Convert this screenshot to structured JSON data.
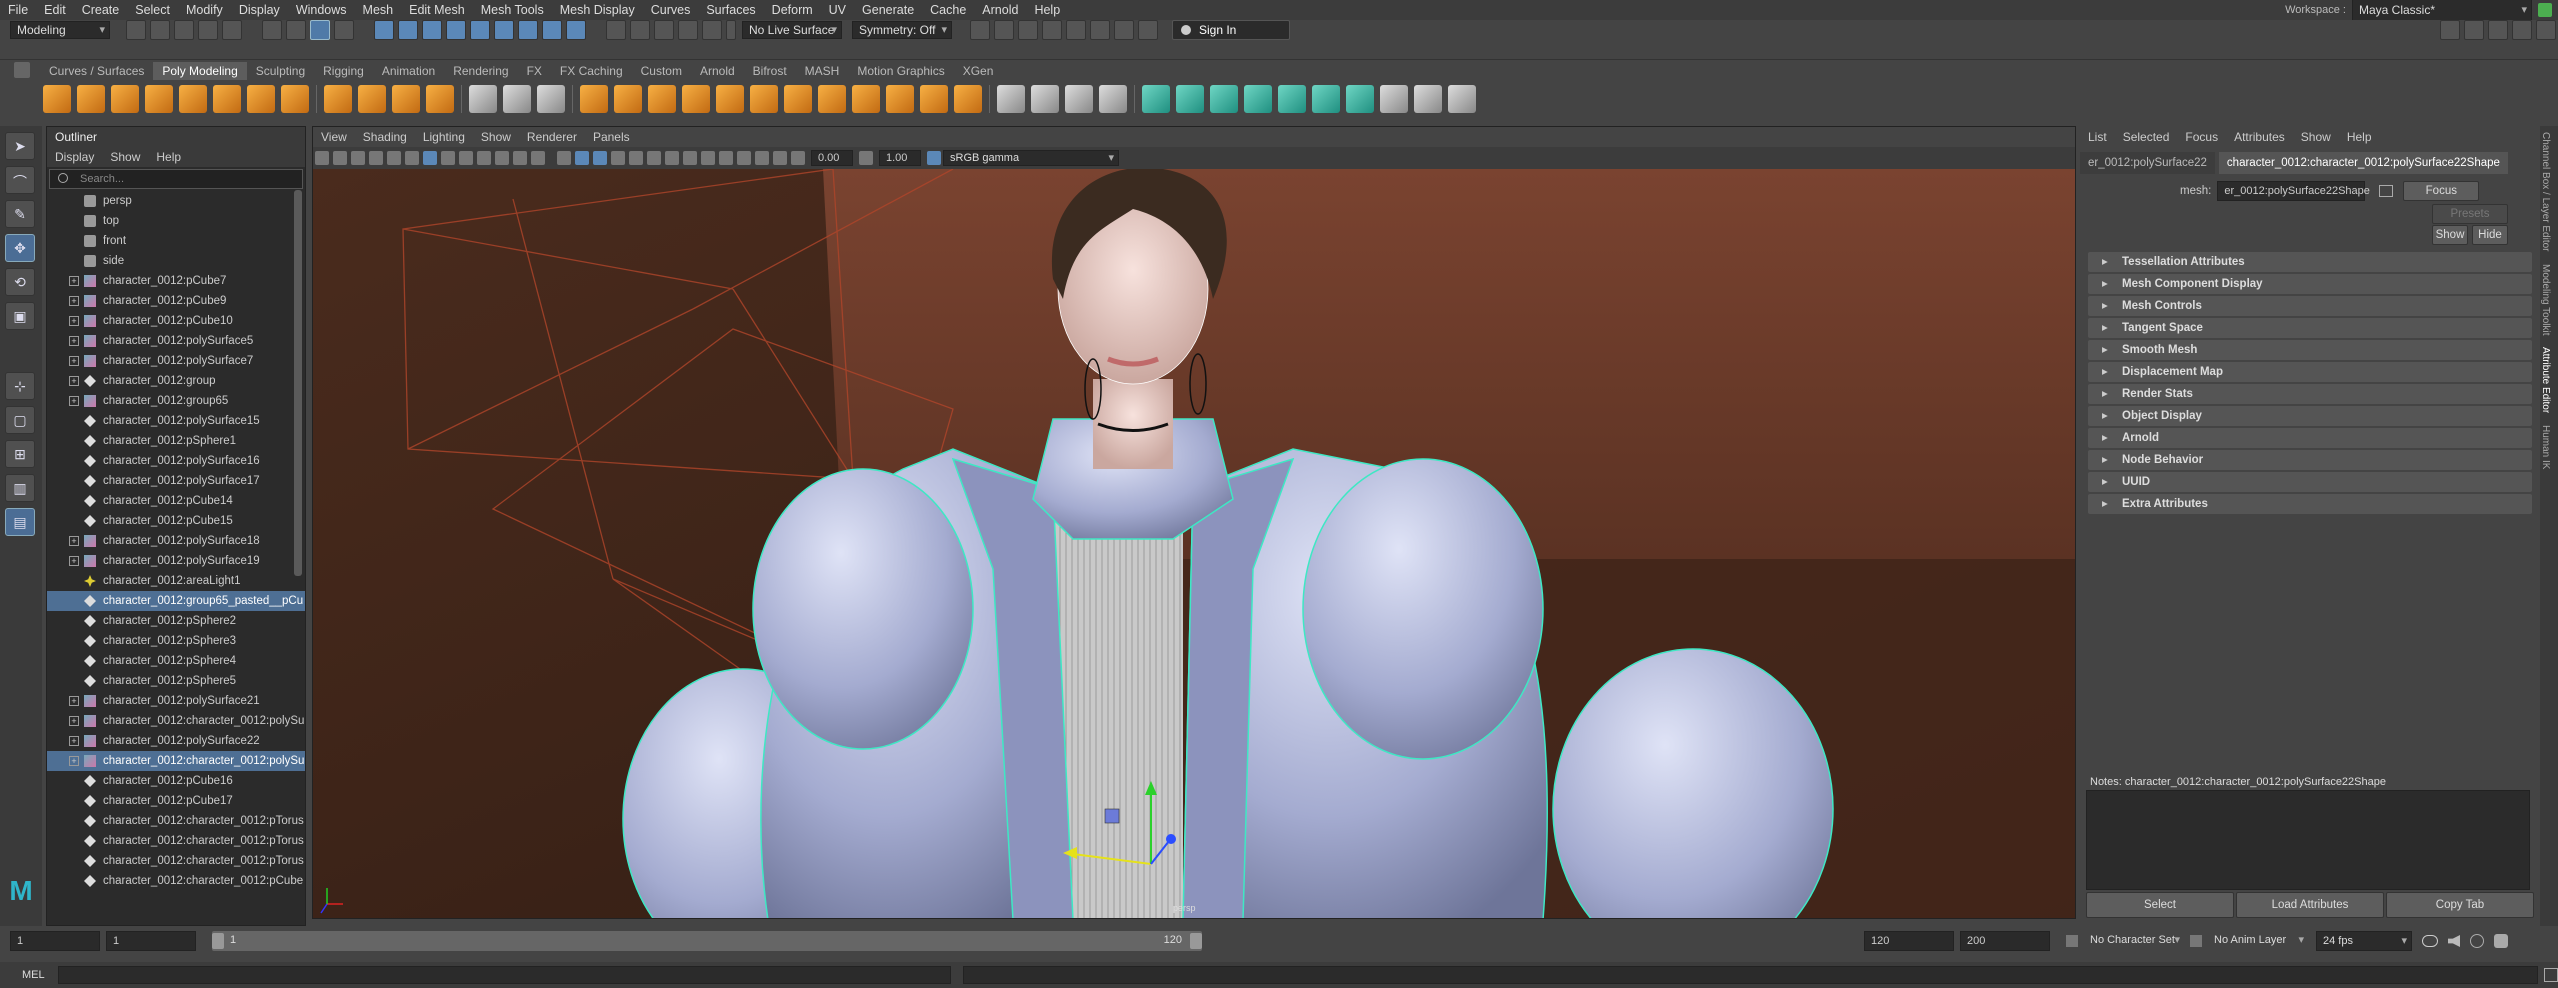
{
  "menubar": {
    "items": [
      "File",
      "Edit",
      "Create",
      "Select",
      "Modify",
      "Display",
      "Windows",
      "Mesh",
      "Edit Mesh",
      "Mesh Tools",
      "Mesh Display",
      "Curves",
      "Surfaces",
      "Deform",
      "UV",
      "Generate",
      "Cache",
      "Arnold",
      "Help"
    ],
    "workspace_label": "Workspace :",
    "workspace_value": "Maya Classic*"
  },
  "status": {
    "mode": "Modeling",
    "live_surface": "No Live Surface",
    "symmetry": "Symmetry: Off",
    "sign_in": "Sign In"
  },
  "shelf_tabs": [
    {
      "label": "Curves / Surfaces",
      "active": false
    },
    {
      "label": "Poly Modeling",
      "active": true
    },
    {
      "label": "Sculpting",
      "active": false
    },
    {
      "label": "Rigging",
      "active": false
    },
    {
      "label": "Animation",
      "active": false
    },
    {
      "label": "Rendering",
      "active": false
    },
    {
      "label": "FX",
      "active": false
    },
    {
      "label": "FX Caching",
      "active": false
    },
    {
      "label": "Custom",
      "active": false
    },
    {
      "label": "Arnold",
      "active": false
    },
    {
      "label": "Bifrost",
      "active": false
    },
    {
      "label": "MASH",
      "active": false
    },
    {
      "label": "Motion Graphics",
      "active": false
    },
    {
      "label": "XGen",
      "active": false
    }
  ],
  "outliner": {
    "title": "Outliner",
    "menu": [
      "Display",
      "Show",
      "Help"
    ],
    "search_placeholder": "Search...",
    "items": [
      {
        "label": "persp",
        "icon": "cam",
        "exp": false,
        "sel": false
      },
      {
        "label": "top",
        "icon": "cam",
        "exp": false,
        "sel": false
      },
      {
        "label": "front",
        "icon": "cam",
        "exp": false,
        "sel": false
      },
      {
        "label": "side",
        "icon": "cam",
        "exp": false,
        "sel": false
      },
      {
        "label": "character_0012:pCube7",
        "icon": "mesh",
        "exp": true,
        "sel": false
      },
      {
        "label": "character_0012:pCube9",
        "icon": "mesh",
        "exp": true,
        "sel": false
      },
      {
        "label": "character_0012:pCube10",
        "icon": "mesh",
        "exp": true,
        "sel": false
      },
      {
        "label": "character_0012:polySurface5",
        "icon": "mesh",
        "exp": true,
        "sel": false
      },
      {
        "label": "character_0012:polySurface7",
        "icon": "mesh",
        "exp": true,
        "sel": false
      },
      {
        "label": "character_0012:group",
        "icon": "grp",
        "exp": true,
        "sel": false
      },
      {
        "label": "character_0012:group65",
        "icon": "mesh",
        "exp": true,
        "sel": false
      },
      {
        "label": "character_0012:polySurface15",
        "icon": "grp",
        "exp": false,
        "sel": false
      },
      {
        "label": "character_0012:pSphere1",
        "icon": "grp",
        "exp": false,
        "sel": false
      },
      {
        "label": "character_0012:polySurface16",
        "icon": "grp",
        "exp": false,
        "sel": false
      },
      {
        "label": "character_0012:polySurface17",
        "icon": "grp",
        "exp": false,
        "sel": false
      },
      {
        "label": "character_0012:pCube14",
        "icon": "grp",
        "exp": false,
        "sel": false
      },
      {
        "label": "character_0012:pCube15",
        "icon": "grp",
        "exp": false,
        "sel": false
      },
      {
        "label": "character_0012:polySurface18",
        "icon": "mesh",
        "exp": true,
        "sel": false
      },
      {
        "label": "character_0012:polySurface19",
        "icon": "mesh",
        "exp": true,
        "sel": false
      },
      {
        "label": "character_0012:areaLight1",
        "icon": "light",
        "exp": false,
        "sel": false
      },
      {
        "label": "character_0012:group65_pasted__pCu",
        "icon": "grp",
        "exp": false,
        "sel": true
      },
      {
        "label": "character_0012:pSphere2",
        "icon": "grp",
        "exp": false,
        "sel": false
      },
      {
        "label": "character_0012:pSphere3",
        "icon": "grp",
        "exp": false,
        "sel": false
      },
      {
        "label": "character_0012:pSphere4",
        "icon": "grp",
        "exp": false,
        "sel": false
      },
      {
        "label": "character_0012:pSphere5",
        "icon": "grp",
        "exp": false,
        "sel": false
      },
      {
        "label": "character_0012:polySurface21",
        "icon": "mesh",
        "exp": true,
        "sel": false
      },
      {
        "label": "character_0012:character_0012:polySu",
        "icon": "mesh",
        "exp": true,
        "sel": false
      },
      {
        "label": "character_0012:polySurface22",
        "icon": "mesh",
        "exp": true,
        "sel": false
      },
      {
        "label": "character_0012:character_0012:polySu",
        "icon": "mesh",
        "exp": true,
        "sel": true
      },
      {
        "label": "character_0012:pCube16",
        "icon": "grp",
        "exp": false,
        "sel": false
      },
      {
        "label": "character_0012:pCube17",
        "icon": "grp",
        "exp": false,
        "sel": false
      },
      {
        "label": "character_0012:character_0012:pTorus",
        "icon": "grp",
        "exp": false,
        "sel": false
      },
      {
        "label": "character_0012:character_0012:pTorus",
        "icon": "grp",
        "exp": false,
        "sel": false
      },
      {
        "label": "character_0012:character_0012:pTorus",
        "icon": "grp",
        "exp": false,
        "sel": false
      },
      {
        "label": "character_0012:character_0012:pCube",
        "icon": "grp",
        "exp": false,
        "sel": false
      }
    ]
  },
  "viewport": {
    "menu": [
      "View",
      "Shading",
      "Lighting",
      "Show",
      "Renderer",
      "Panels"
    ],
    "exposure": "0.00",
    "gamma": "1.00",
    "color_space": "sRGB gamma",
    "camera_label": "persp"
  },
  "attr": {
    "menu": [
      "List",
      "Selected",
      "Focus",
      "Attributes",
      "Show",
      "Help"
    ],
    "tabs": [
      {
        "label": "er_0012:polySurface22",
        "active": false
      },
      {
        "label": "character_0012:character_0012:polySurface22Shape",
        "active": true
      }
    ],
    "mesh_label": "mesh:",
    "mesh_value": "er_0012:polySurface22Shape",
    "focus": "Focus",
    "presets": "Presets",
    "show": "Show",
    "hide": "Hide",
    "sections": [
      "Tessellation Attributes",
      "Mesh Component Display",
      "Mesh Controls",
      "Tangent Space",
      "Smooth Mesh",
      "Displacement Map",
      "Render Stats",
      "Object Display",
      "Arnold",
      "Node Behavior",
      "UUID",
      "Extra Attributes"
    ],
    "notes": "Notes:  character_0012:character_0012:polySurface22Shape",
    "buttons": [
      "Select",
      "Load Attributes",
      "Copy Tab"
    ]
  },
  "right_tabs": [
    "Channel Box / Layer Editor",
    "Modeling Toolkit",
    "Attribute Editor",
    "Human IK"
  ],
  "timeslider": {
    "start": "1",
    "current": "1",
    "range_start": "1",
    "range_end": "120",
    "end": "120",
    "max": "200",
    "character_set": "No Character Set",
    "anim_layer": "No Anim Layer",
    "fps": "24 fps"
  },
  "cmdline": {
    "label": "MEL"
  },
  "colors": {
    "accent": "#5b88b8",
    "wire": "#3ee8c4",
    "jacket": "#a9b1d6",
    "wall": "#6b3a28"
  }
}
